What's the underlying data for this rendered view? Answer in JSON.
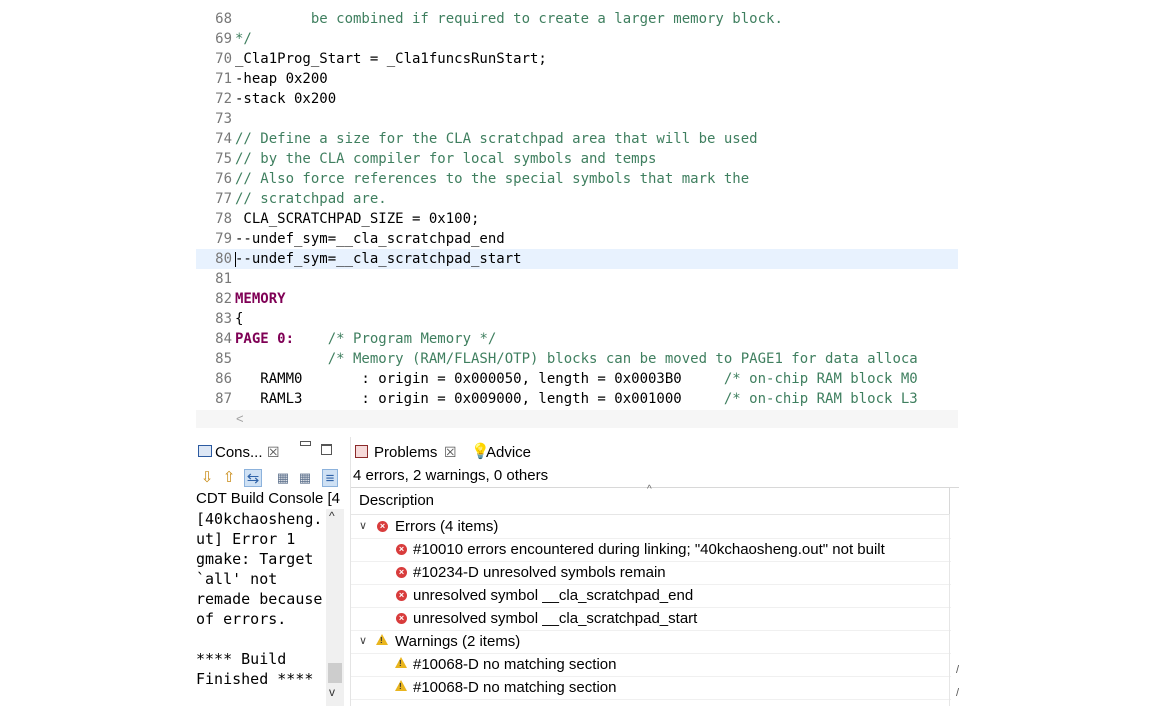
{
  "editor": {
    "lines": [
      {
        "num": "68",
        "parts": [
          {
            "t": "         be combined if required to create a larger memory block.",
            "c": "cm"
          }
        ]
      },
      {
        "num": "69",
        "parts": [
          {
            "t": "*/",
            "c": "cm"
          }
        ]
      },
      {
        "num": "70",
        "parts": [
          {
            "t": "_Cla1Prog_Start = _Cla1funcsRunStart;",
            "c": ""
          }
        ]
      },
      {
        "num": "71",
        "parts": [
          {
            "t": "-heap 0x200",
            "c": ""
          }
        ]
      },
      {
        "num": "72",
        "parts": [
          {
            "t": "-stack 0x200",
            "c": ""
          }
        ]
      },
      {
        "num": "73",
        "parts": []
      },
      {
        "num": "74",
        "parts": [
          {
            "t": "// Define a size for the CLA scratchpad area that will be used",
            "c": "cm"
          }
        ]
      },
      {
        "num": "75",
        "parts": [
          {
            "t": "// by the CLA compiler for local symbols and temps",
            "c": "cm"
          }
        ]
      },
      {
        "num": "76",
        "parts": [
          {
            "t": "// Also force references to the special symbols that mark the",
            "c": "cm"
          }
        ]
      },
      {
        "num": "77",
        "parts": [
          {
            "t": "// scratchpad are.",
            "c": "cm"
          }
        ]
      },
      {
        "num": "78",
        "parts": [
          {
            "t": " CLA_SCRATCHPAD_SIZE = 0x100;",
            "c": ""
          }
        ]
      },
      {
        "num": "79",
        "parts": [
          {
            "t": "--undef_sym=__cla_scratchpad_end",
            "c": ""
          }
        ]
      },
      {
        "num": "80",
        "parts": [
          {
            "t": "--undef_sym=__cla_scratchpad_start",
            "c": ""
          }
        ],
        "current": true
      },
      {
        "num": "81",
        "parts": []
      },
      {
        "num": "82",
        "parts": [
          {
            "t": "MEMORY",
            "c": "kw"
          }
        ]
      },
      {
        "num": "83",
        "parts": [
          {
            "t": "{",
            "c": ""
          }
        ]
      },
      {
        "num": "84",
        "parts": [
          {
            "t": "PAGE 0:",
            "c": "kw"
          },
          {
            "t": "    /* Program Memory */",
            "c": "cm"
          }
        ]
      },
      {
        "num": "85",
        "parts": [
          {
            "t": "           /* Memory (RAM/FLASH/OTP) blocks can be moved to PAGE1 for data alloca",
            "c": "cm"
          }
        ]
      },
      {
        "num": "86",
        "parts": [
          {
            "t": "   RAMM0       : origin = 0x000050, length = 0x0003B0     ",
            "c": ""
          },
          {
            "t": "/* on-chip RAM block M0",
            "c": "cm"
          }
        ]
      },
      {
        "num": "87",
        "parts": [
          {
            "t": "   RAML3       : origin = 0x009000, length = 0x001000     ",
            "c": ""
          },
          {
            "t": "/* on-chip RAM block L3",
            "c": "cm"
          }
        ]
      }
    ],
    "hscroll_left": "<"
  },
  "console": {
    "tab_label": "Cons...",
    "tab_close": "☒",
    "header": "CDT Build Console [4",
    "text": "[40kchaosheng.\nut] Error 1\ngmake: Target\n`all' not\nremade because\nof errors.\n\n**** Build\nFinished ****",
    "scroll_up": "^",
    "scroll_down": "v"
  },
  "problems": {
    "tab_label": "Problems",
    "tab_close": "☒",
    "advice_label": "Advice",
    "summary": "4 errors, 2 warnings, 0 others",
    "column_description": "Description",
    "groups": [
      {
        "label": "Errors (4 items)",
        "kind": "error",
        "items": [
          "#10010 errors encountered during linking; \"40kchaosheng.out\" not built",
          "#10234-D unresolved symbols remain",
          "unresolved symbol __cla_scratchpad_end",
          "unresolved symbol __cla_scratchpad_start"
        ]
      },
      {
        "label": "Warnings (2 items)",
        "kind": "warning",
        "items": [
          "#10068-D no matching section",
          "#10068-D no matching section"
        ]
      }
    ]
  },
  "colors": {
    "comment": "#3f7f5f",
    "keyword": "#7f0055",
    "current_line": "#e8f2fe",
    "error": "#d83c3c",
    "warning": "#e9b51e"
  },
  "icons": {
    "console_tab": "console-icon",
    "problems_tab": "problems-icon",
    "advice_tab": "lightbulb-icon",
    "error": "error-icon",
    "warning": "warning-icon"
  }
}
